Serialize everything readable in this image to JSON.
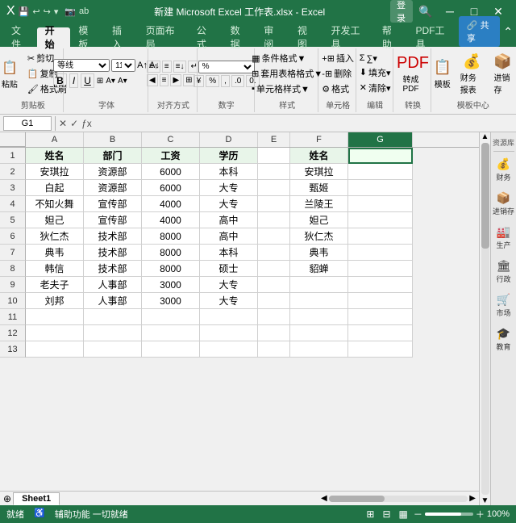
{
  "titlebar": {
    "title": "新建 Microsoft Excel 工作表.xlsx - Excel",
    "login": "登录"
  },
  "quickaccess": {
    "icons": [
      "💾",
      "↩",
      "↪",
      "⊞",
      "📷"
    ]
  },
  "ribbon_tabs": [
    "文件",
    "开始",
    "模板",
    "插入",
    "页面布局",
    "公式",
    "数据",
    "审阅",
    "视图",
    "开发工具",
    "帮助",
    "PDF工具"
  ],
  "active_tab": "开始",
  "share_label": "共享",
  "ribbon_groups": {
    "clipboard": {
      "label": "剪贴板",
      "buttons": [
        "✂",
        "📋",
        "🖌"
      ]
    },
    "font": {
      "label": "字体"
    },
    "align": {
      "label": "对齐方式"
    },
    "number": {
      "label": "数字"
    },
    "styles": {
      "label": "样式",
      "items": [
        "条件格式▼",
        "套用表格格式▼",
        "单元格样式▼"
      ]
    },
    "cells": {
      "label": "单元格"
    },
    "editing": {
      "label": "编辑"
    },
    "convert": {
      "label": "转换",
      "buttons": [
        "转成PDF"
      ]
    },
    "template": {
      "label": "模板中心",
      "buttons": [
        "模板",
        "财务报表",
        "进销存"
      ]
    }
  },
  "formula_bar": {
    "cell_ref": "G1",
    "formula": ""
  },
  "columns": [
    "A",
    "B",
    "C",
    "D",
    "E",
    "F",
    "G"
  ],
  "headers": {
    "row": [
      "姓名",
      "部门",
      "工资",
      "学历",
      "",
      "姓名",
      ""
    ]
  },
  "data_rows": [
    {
      "row": 1,
      "cells": [
        "姓名",
        "部门",
        "工资",
        "学历",
        "",
        "姓名",
        ""
      ]
    },
    {
      "row": 2,
      "cells": [
        "安琪拉",
        "资源部",
        "6000",
        "本科",
        "",
        "安琪拉",
        ""
      ]
    },
    {
      "row": 3,
      "cells": [
        "白起",
        "资源部",
        "6000",
        "大专",
        "",
        "甄姬",
        ""
      ]
    },
    {
      "row": 4,
      "cells": [
        "不知火舞",
        "宣传部",
        "4000",
        "大专",
        "",
        "兰陵王",
        ""
      ]
    },
    {
      "row": 5,
      "cells": [
        "妲己",
        "宣传部",
        "4000",
        "高中",
        "",
        "妲己",
        ""
      ]
    },
    {
      "row": 6,
      "cells": [
        "狄仁杰",
        "技术部",
        "8000",
        "高中",
        "",
        "狄仁杰",
        ""
      ]
    },
    {
      "row": 7,
      "cells": [
        "典韦",
        "技术部",
        "8000",
        "本科",
        "",
        "典韦",
        ""
      ]
    },
    {
      "row": 8,
      "cells": [
        "韩信",
        "技术部",
        "8000",
        "硕士",
        "",
        "貂蝉",
        ""
      ]
    },
    {
      "row": 9,
      "cells": [
        "老夫子",
        "人事部",
        "3000",
        "大专",
        "",
        "",
        ""
      ]
    },
    {
      "row": 10,
      "cells": [
        "刘邦",
        "人事部",
        "3000",
        "大专",
        "",
        "",
        ""
      ]
    },
    {
      "row": 11,
      "cells": [
        "",
        "",
        "",
        "",
        "",
        "",
        ""
      ]
    },
    {
      "row": 12,
      "cells": [
        "",
        "",
        "",
        "",
        "",
        "",
        ""
      ]
    },
    {
      "row": 13,
      "cells": [
        "",
        "",
        "",
        "",
        "",
        "",
        ""
      ]
    }
  ],
  "sheet_tabs": [
    "Sheet1"
  ],
  "status": {
    "ready": "就绪",
    "accessibility": "辅助功能 一切就绪",
    "zoom": "100%"
  },
  "sidebar_items": [
    {
      "icon": "📚",
      "label": "资源库"
    },
    {
      "icon": "💰",
      "label": "财务"
    },
    {
      "icon": "📦",
      "label": "进销存"
    },
    {
      "icon": "🏭",
      "label": "生产"
    },
    {
      "icon": "🏛",
      "label": "行政"
    },
    {
      "icon": "🛒",
      "label": "市场"
    },
    {
      "icon": "🎓",
      "label": "教育"
    }
  ]
}
